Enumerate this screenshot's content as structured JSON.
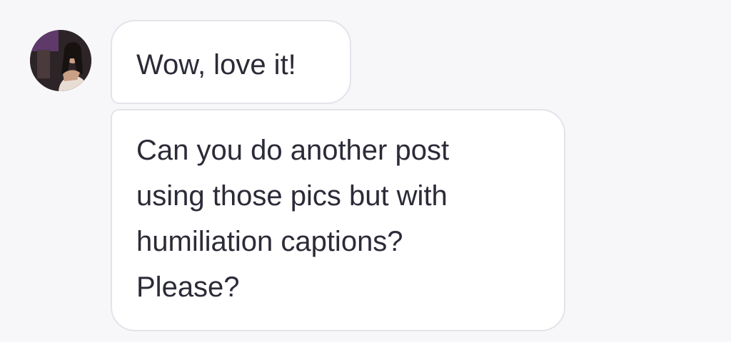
{
  "sender": {
    "avatar_icon": "profile-photo-avatar"
  },
  "messages": [
    {
      "text": "Wow, love it!"
    },
    {
      "lines": [
        "Can you do another post",
        "using those pics but with",
        "humiliation captions?",
        "Please?"
      ]
    }
  ],
  "colors": {
    "background": "#f7f7f9",
    "bubble_background": "#ffffff",
    "bubble_border": "#e3e3ea",
    "text": "#2b2b38"
  }
}
